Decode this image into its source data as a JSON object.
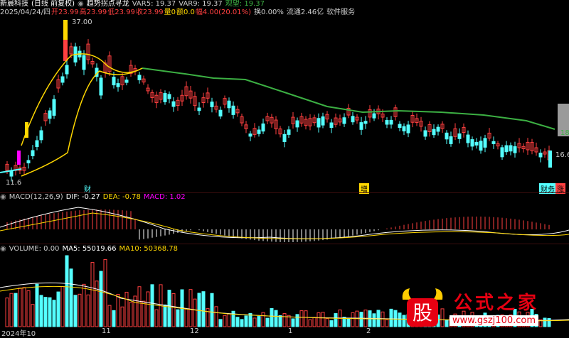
{
  "header": {
    "stock": "新晨科技",
    "period": "(日线 前复权)",
    "indicator": "趋势拐点寻龙",
    "var5": "VAR5: 19.37",
    "var9": "VAR9: 19.37",
    "watch": "观望: 19.37"
  },
  "quote": {
    "date": "2025/04/24/四",
    "open": "开23.99",
    "high": "高23.99",
    "low": "低23.99",
    "close": "收23.99",
    "vol": "量0",
    "amount": "额0.0",
    "change": "幅4.00(20.01%)",
    "turnover": "换0.00%",
    "float": "流通2.46亿",
    "sector": "软件服务"
  },
  "price_labels": {
    "high": "37.00",
    "low": "11.6",
    "right_a": "18",
    "right_b": "16.6"
  },
  "event_tags": {
    "cai": "财",
    "zeng": "增",
    "cai2": "财务",
    "zhang": "涨"
  },
  "macd": {
    "title": "MACD(12,26,9)",
    "dif": "DIF: -0.27",
    "dea": "DEA: -0.78",
    "macd": "MACD: 1.02"
  },
  "volume": {
    "title": "VOLUME: 0.00",
    "ma5": "MA5: 55019.66",
    "ma10": "MA10: 50368.78"
  },
  "dates": {
    "d1": "2024年10",
    "d2": "11",
    "d3": "12",
    "d4": "1",
    "d5": "2"
  },
  "watermark": {
    "title": "公式之家",
    "url": "www.gszj100.com",
    "logo_char": "股"
  },
  "colors": {
    "up": "#ff4040",
    "down": "#54ffff",
    "yellow": "#ffd700",
    "green": "#3cb043",
    "magenta": "#ff00ff",
    "white": "#ffffff"
  }
}
